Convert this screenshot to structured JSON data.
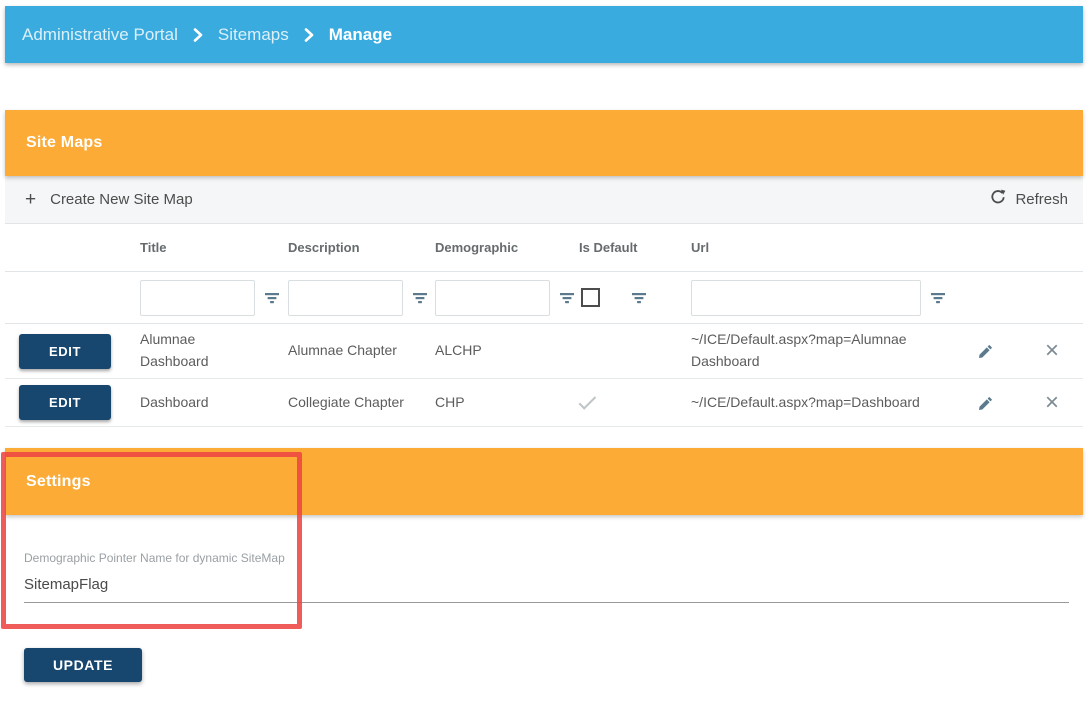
{
  "breadcrumb": {
    "items": [
      {
        "label": "Administrative Portal"
      },
      {
        "label": "Sitemaps"
      },
      {
        "label": "Manage"
      }
    ]
  },
  "sitemaps": {
    "title": "Site Maps",
    "toolbar": {
      "create": "Create New Site Map",
      "refresh": "Refresh"
    },
    "table": {
      "headers": {
        "title": "Title",
        "description": "Description",
        "demographic": "Demographic",
        "is_default": "Is Default",
        "url": "Url"
      },
      "edit_label": "EDIT",
      "rows": [
        {
          "title": "Alumnae Dashboard",
          "description": "Alumnae Chapter",
          "demographic": "ALCHP",
          "is_default": "unchecked",
          "url": "~/ICE/Default.aspx?map=Alumnae Dashboard"
        },
        {
          "title": "Dashboard",
          "description": "Collegiate Chapter",
          "demographic": "CHP",
          "is_default": "checked",
          "url": "~/ICE/Default.aspx?map=Dashboard"
        }
      ]
    }
  },
  "settings": {
    "title": "Settings",
    "field_label": "Demographic Pointer Name for dynamic SiteMap",
    "field_value": "SitemapFlag",
    "update_label": "UPDATE"
  },
  "icons": {
    "plus": "+",
    "close": "×"
  },
  "colors": {
    "topbar_blue": "#3aabdf",
    "header_orange": "#fbab36",
    "button_navy": "#17466e",
    "annotation_red": "#ee4543",
    "icon_slate": "#5b7a8e"
  }
}
